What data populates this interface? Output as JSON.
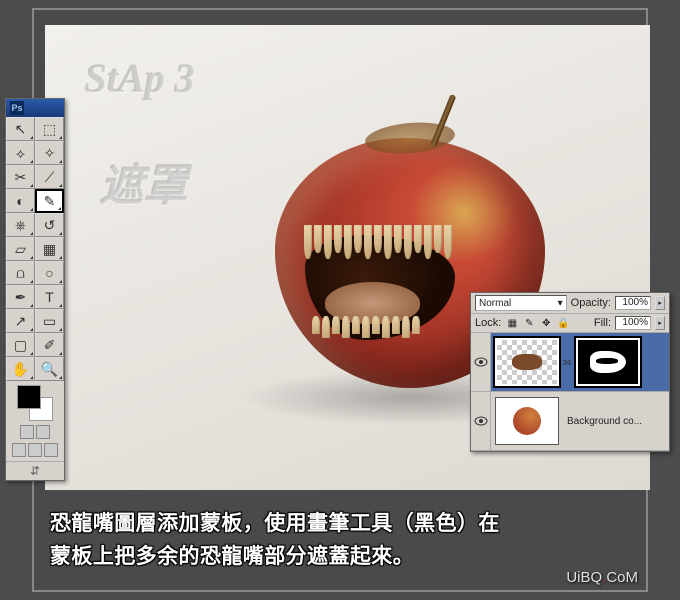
{
  "canvas": {
    "step_label": "StAp 3",
    "mask_label": "遮罩"
  },
  "toolbox": {
    "ps_label": "Ps",
    "tools": [
      {
        "name": "move-tool",
        "glyph": "↖"
      },
      {
        "name": "marquee-tool",
        "glyph": "⬚"
      },
      {
        "name": "lasso-tool",
        "glyph": "⟡"
      },
      {
        "name": "magic-wand-tool",
        "glyph": "✧"
      },
      {
        "name": "crop-tool",
        "glyph": "✂"
      },
      {
        "name": "slice-tool",
        "glyph": "⟋"
      },
      {
        "name": "healing-brush-tool",
        "glyph": "◐"
      },
      {
        "name": "brush-tool",
        "glyph": "✎",
        "selected": true
      },
      {
        "name": "clone-stamp-tool",
        "glyph": "⎈"
      },
      {
        "name": "history-brush-tool",
        "glyph": "↺"
      },
      {
        "name": "eraser-tool",
        "glyph": "▱"
      },
      {
        "name": "gradient-tool",
        "glyph": "▦"
      },
      {
        "name": "blur-tool",
        "glyph": "⩍"
      },
      {
        "name": "dodge-tool",
        "glyph": "○"
      },
      {
        "name": "pen-tool",
        "glyph": "✒"
      },
      {
        "name": "type-tool",
        "glyph": "T"
      },
      {
        "name": "path-select-tool",
        "glyph": "↗"
      },
      {
        "name": "shape-tool",
        "glyph": "▭"
      },
      {
        "name": "notes-tool",
        "glyph": "▢"
      },
      {
        "name": "eyedropper-tool",
        "glyph": "✐"
      },
      {
        "name": "hand-tool",
        "glyph": "✋"
      },
      {
        "name": "zoom-tool",
        "glyph": "🔍"
      }
    ],
    "swatch": {
      "fg": "#000000",
      "bg": "#ffffff"
    }
  },
  "layers_panel": {
    "blend_mode": "Normal",
    "opacity_label": "Opacity:",
    "opacity_value": "100%",
    "lock_label": "Lock:",
    "fill_label": "Fill:",
    "fill_value": "100%",
    "layers": [
      {
        "name": "",
        "type": "mouth-with-mask",
        "selected": true,
        "visible": true
      },
      {
        "name": "Background co...",
        "type": "apple",
        "selected": false,
        "visible": true
      }
    ]
  },
  "caption": {
    "line1": "恐龍嘴圖層添加蒙板，使用畫筆工具（黑色）在",
    "line2": "蒙板上把多余的恐龍嘴部分遮蓋起來。"
  },
  "watermark": {
    "text_a": "UiBQ",
    "text_b": "CoM"
  }
}
